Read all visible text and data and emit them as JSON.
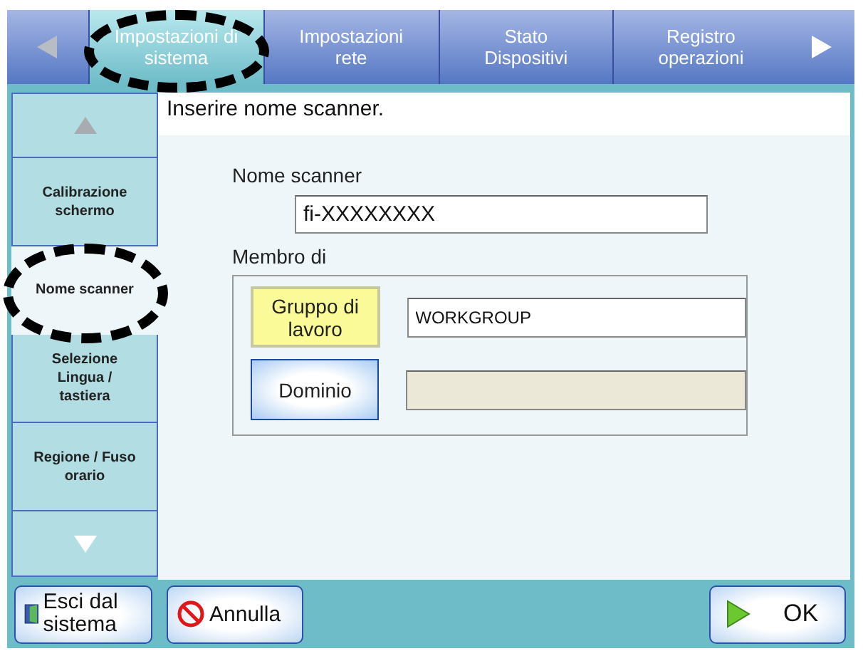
{
  "tabs": [
    {
      "label": "Impostazioni di sistema",
      "selected": true
    },
    {
      "label": "Impostazioni rete",
      "selected": false
    },
    {
      "label": "Stato Dispositivi",
      "selected": false
    },
    {
      "label": "Registro operazioni",
      "selected": false
    }
  ],
  "sidebar": {
    "items": [
      {
        "label": "Calibrazione schermo",
        "selected": false
      },
      {
        "label": "Nome scanner",
        "selected": true
      },
      {
        "label": "Selezione Lingua / tastiera",
        "selected": false
      },
      {
        "label": "Regione / Fuso orario",
        "selected": false
      }
    ]
  },
  "instruction": "Inserire nome scanner.",
  "scanner_name": {
    "label": "Nome scanner",
    "value": "fi-XXXXXXXX"
  },
  "membership": {
    "label": "Membro di",
    "options": [
      {
        "label": "Gruppo di lavoro",
        "selected": true,
        "field": {
          "value": "WORKGROUP",
          "disabled": false
        }
      },
      {
        "label": "Dominio",
        "selected": false,
        "field": {
          "disabled": true
        }
      }
    ]
  },
  "footer": {
    "buttons": [
      {
        "kind": "logout",
        "label": "Esci dal sistema"
      },
      {
        "kind": "cancel",
        "label": "Annulla"
      },
      {
        "kind": "ok",
        "label": "OK"
      }
    ]
  }
}
